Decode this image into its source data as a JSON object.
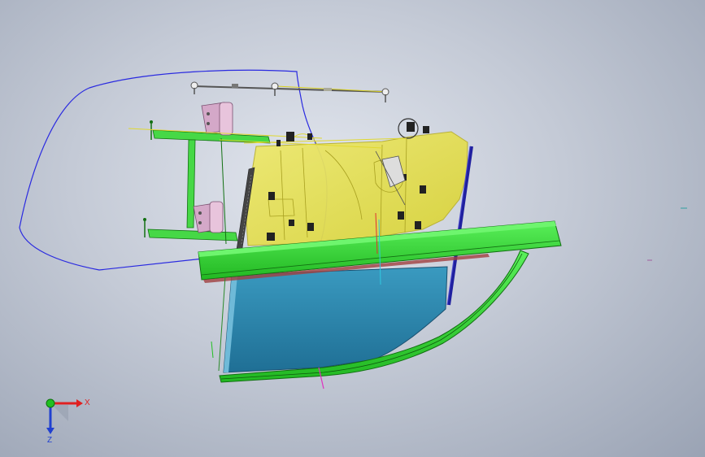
{
  "viewport": {
    "background_center": "#e2e6ee",
    "background_edge": "#9aa3b4"
  },
  "model": {
    "parts": [
      {
        "name": "door-outline-curve",
        "color": "#2a2ae0"
      },
      {
        "name": "window-glass",
        "color": "#2a8ab0"
      },
      {
        "name": "inner-panel",
        "color": "#e6e050"
      },
      {
        "name": "belt-rail",
        "color": "#38e038"
      },
      {
        "name": "hinge-assembly",
        "color": "#40d040"
      },
      {
        "name": "hinge-brackets",
        "color": "#d4a8c8"
      },
      {
        "name": "check-link-rod",
        "color": "#555555"
      },
      {
        "name": "glass-run-channel",
        "color": "#2020a0"
      }
    ]
  },
  "triad": {
    "x_label": "X",
    "y_label": "Y",
    "z_label": "Z",
    "x_color": "#e02020",
    "y_color": "#20c020",
    "z_color": "#2040d0"
  }
}
